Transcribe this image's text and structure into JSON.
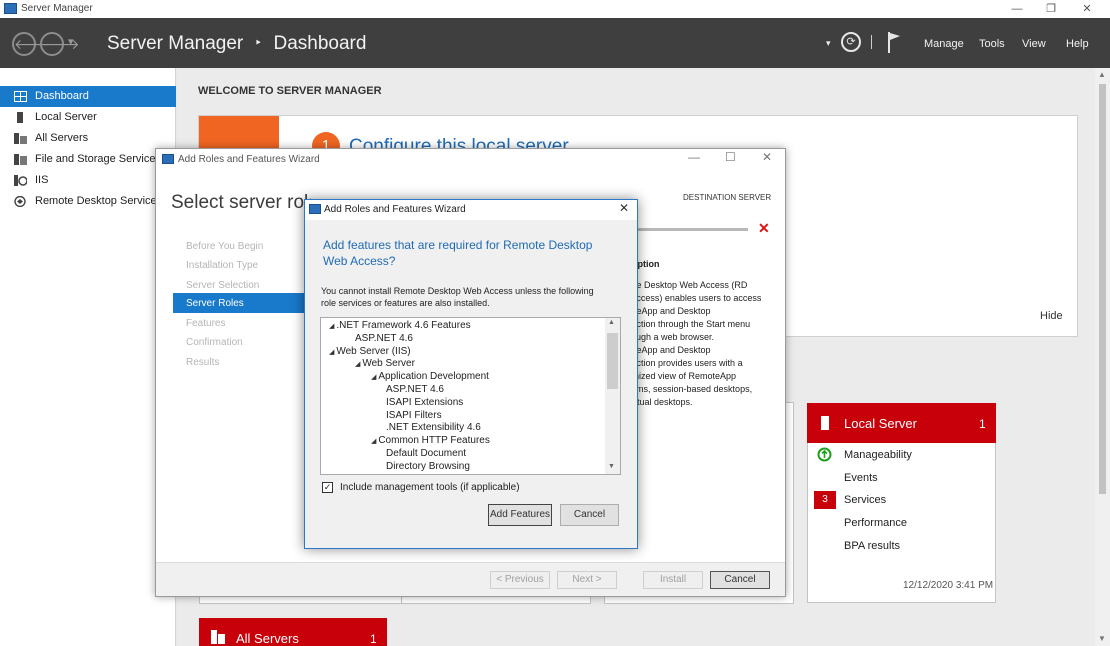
{
  "window": {
    "title": "Server Manager",
    "minimize": "—",
    "restore": "❐",
    "close": "✕"
  },
  "header": {
    "back_icon": "🡐",
    "forward_icon": "🡒",
    "dropdown_icon": "▾",
    "app": "Server Manager",
    "separator": "‣",
    "page": "Dashboard",
    "menus": [
      "Manage",
      "Tools",
      "View",
      "Help"
    ],
    "refresh_icon": "⟳",
    "flag_icon": "flag"
  },
  "sidebar": {
    "items": [
      {
        "label": "Dashboard",
        "icon": "dashboard-icon"
      },
      {
        "label": "Local Server",
        "icon": "server-icon"
      },
      {
        "label": "All Servers",
        "icon": "servers-icon"
      },
      {
        "label": "File and Storage Services",
        "icon": "storage-icon"
      },
      {
        "label": "IIS",
        "icon": "iis-icon"
      },
      {
        "label": "Remote Desktop Services",
        "icon": "remote-desktop-icon"
      }
    ]
  },
  "main": {
    "welcome": "WELCOME TO SERVER MANAGER",
    "step_number": "1",
    "step_text": "Configure this local server",
    "hide": "Hide",
    "local_server_tile": {
      "title": "Local Server",
      "count": "1",
      "items": [
        "Manageability",
        "Events",
        "Services",
        "Performance",
        "BPA results"
      ],
      "services_count": "3",
      "timestamp": "12/12/2020 3:41 PM"
    },
    "all_servers_tile": {
      "title": "All Servers",
      "count": "1"
    }
  },
  "wizard": {
    "title": "Add Roles and Features Wizard",
    "heading": "Select server roles",
    "dest_label": "DESTINATION SERVER",
    "steps": [
      "Before You Begin",
      "Installation Type",
      "Server Selection",
      "Server Roles",
      "Features",
      "Confirmation",
      "Results"
    ],
    "desc_heading": "Description",
    "desc_lines": [
      "Remote Desktop Web Access (RD",
      "Web Access) enables users to access",
      "RemoteApp and Desktop",
      "Connection through the Start menu",
      "or through a web browser.",
      "RemoteApp and Desktop",
      "Connection provides users with a",
      "customized view of RemoteApp",
      "programs, session-based desktops,",
      "and virtual desktops."
    ],
    "buttons": {
      "previous": "< Previous",
      "next": "Next >",
      "install": "Install",
      "cancel": "Cancel"
    }
  },
  "dialog": {
    "title": "Add Roles and Features Wizard",
    "heading_line1": "Add features that are required for Remote Desktop",
    "heading_line2": "Web Access?",
    "body_line1": "You cannot install Remote Desktop Web Access unless the following",
    "body_line2": "role services or features are also installed.",
    "tree": [
      {
        "label": ".NET Framework 4.6 Features",
        "level": 0,
        "expanded": true
      },
      {
        "label": "ASP.NET 4.6",
        "level": 1
      },
      {
        "label": "Web Server (IIS)",
        "level": 0,
        "expanded": true
      },
      {
        "label": "Web Server",
        "level": 1,
        "expanded": true
      },
      {
        "label": "Application Development",
        "level": 2,
        "expanded": true
      },
      {
        "label": "ASP.NET 4.6",
        "level": 3
      },
      {
        "label": "ISAPI Extensions",
        "level": 3
      },
      {
        "label": "ISAPI Filters",
        "level": 3
      },
      {
        "label": ".NET Extensibility 4.6",
        "level": 3
      },
      {
        "label": "Common HTTP Features",
        "level": 2,
        "expanded": true
      },
      {
        "label": "Default Document",
        "level": 3
      },
      {
        "label": "Directory Browsing",
        "level": 3
      }
    ],
    "checkbox_label": "Include management tools (if applicable)",
    "checkbox_checked": true,
    "add_features": "Add Features",
    "cancel": "Cancel"
  }
}
